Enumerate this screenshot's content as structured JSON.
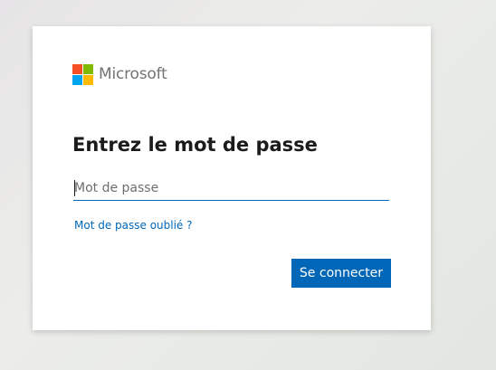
{
  "brand": {
    "name": "Microsoft",
    "logo_colors": [
      "#f25022",
      "#7fba00",
      "#00a4ef",
      "#ffb900"
    ]
  },
  "signin": {
    "title": "Entrez le mot de passe",
    "password_placeholder": "Mot de passe",
    "password_value": "",
    "forgot_link": "Mot de passe oublié ?",
    "submit_label": "Se connecter"
  },
  "colors": {
    "accent": "#0067b8",
    "title_text": "#1b1b1b",
    "logo_text": "#737373"
  }
}
